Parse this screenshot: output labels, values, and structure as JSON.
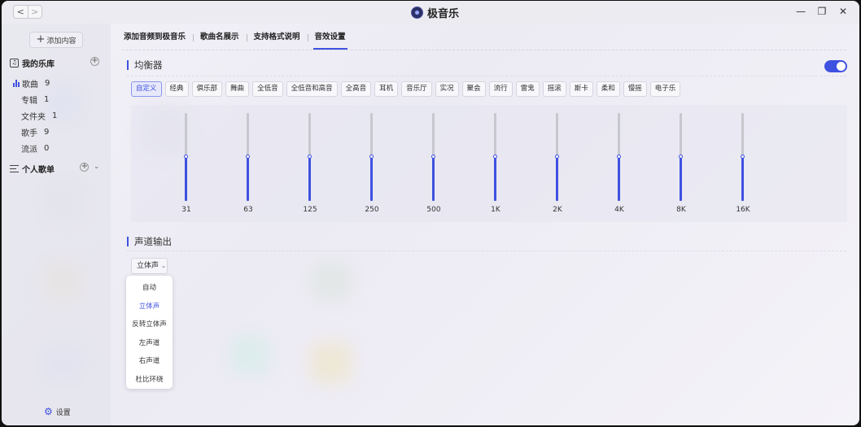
{
  "window": {
    "title": "极音乐",
    "nav_back": "<",
    "nav_forward": ">"
  },
  "sidebar": {
    "add_button": "添加内容",
    "library_title": "我的乐库",
    "library_items": [
      {
        "label": "歌曲",
        "count": "9",
        "active": true
      },
      {
        "label": "专辑",
        "count": "1",
        "active": false
      },
      {
        "label": "文件夹",
        "count": "1",
        "active": false
      },
      {
        "label": "歌手",
        "count": "9",
        "active": false
      },
      {
        "label": "流派",
        "count": "0",
        "active": false
      }
    ],
    "playlists_title": "个人歌单",
    "settings_label": "设置"
  },
  "tabs": [
    {
      "label": "添加音频到极音乐",
      "active": false
    },
    {
      "label": "歌曲名展示",
      "active": false
    },
    {
      "label": "支持格式说明",
      "active": false
    },
    {
      "label": "音效设置",
      "active": true
    }
  ],
  "equalizer": {
    "title": "均衡器",
    "enabled": true,
    "presets": [
      "自定义",
      "经典",
      "俱乐部",
      "舞曲",
      "全低音",
      "全低音和高音",
      "全高音",
      "耳机",
      "音乐厅",
      "实况",
      "聚会",
      "流行",
      "雷鬼",
      "摇滚",
      "斯卡",
      "柔和",
      "慢摇",
      "电子乐"
    ],
    "active_preset": "自定义",
    "bands": [
      {
        "freq": "31",
        "level": 0.5
      },
      {
        "freq": "63",
        "level": 0.5
      },
      {
        "freq": "125",
        "level": 0.5
      },
      {
        "freq": "250",
        "level": 0.5
      },
      {
        "freq": "500",
        "level": 0.5
      },
      {
        "freq": "1K",
        "level": 0.5
      },
      {
        "freq": "2K",
        "level": 0.5
      },
      {
        "freq": "4K",
        "level": 0.5
      },
      {
        "freq": "8K",
        "level": 0.5
      },
      {
        "freq": "16K",
        "level": 0.5
      }
    ]
  },
  "channel": {
    "title": "声道输出",
    "selected": "立体声",
    "options": [
      "自动",
      "立体声",
      "反转立体声",
      "左声道",
      "右声道",
      "杜比环绕"
    ]
  },
  "colors": {
    "accent": "#3f51e0"
  }
}
